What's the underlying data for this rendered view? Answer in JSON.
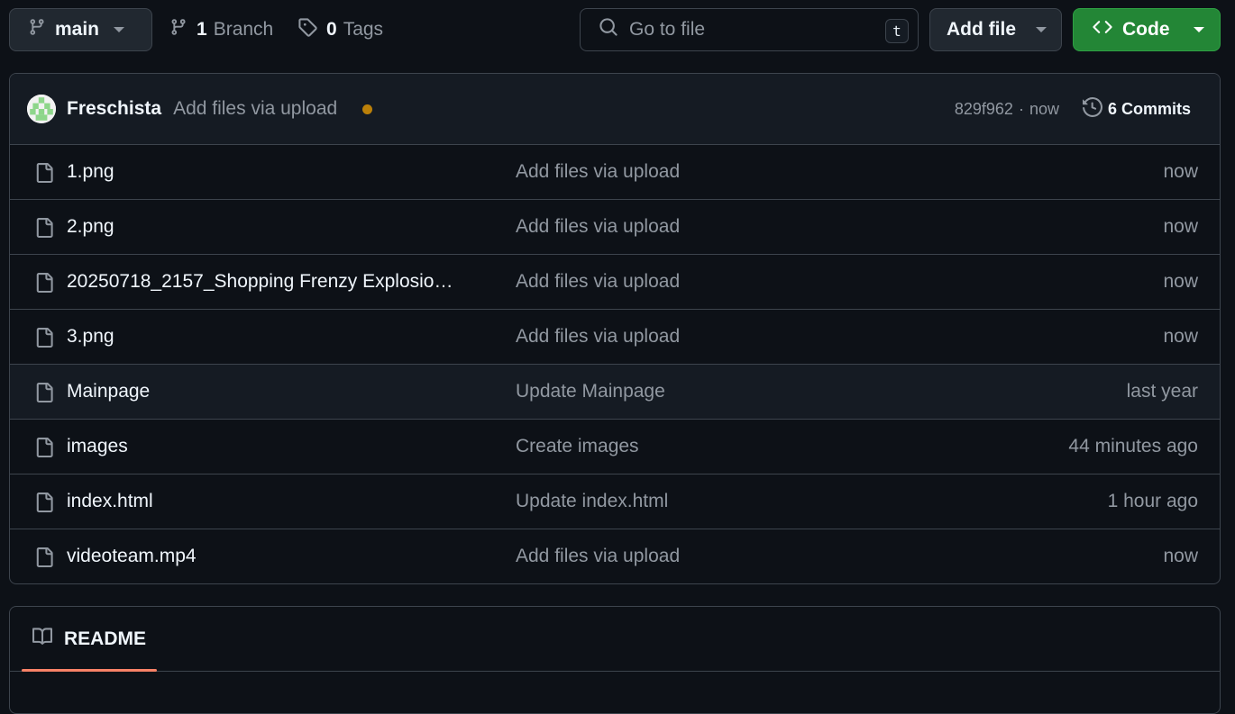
{
  "toolbar": {
    "branch": "main",
    "branches_count": "1",
    "branches_label": "Branch",
    "tags_count": "0",
    "tags_label": "Tags",
    "search_placeholder": "Go to file",
    "search_shortcut": "t",
    "add_file_label": "Add file",
    "code_label": "Code"
  },
  "latest_commit": {
    "author": "Freschista",
    "message": "Add files via upload",
    "hash": "829f962",
    "separator": "·",
    "time": "now",
    "commits_label": "6 Commits"
  },
  "files": [
    {
      "name": "1.png",
      "commit": "Add files via upload",
      "time": "now"
    },
    {
      "name": "2.png",
      "commit": "Add files via upload",
      "time": "now"
    },
    {
      "name": "20250718_2157_Shopping Frenzy Explosio…",
      "commit": "Add files via upload",
      "time": "now"
    },
    {
      "name": "3.png",
      "commit": "Add files via upload",
      "time": "now"
    },
    {
      "name": "Mainpage",
      "commit": "Update Mainpage",
      "time": "last year"
    },
    {
      "name": "images",
      "commit": "Create images",
      "time": "44 minutes ago"
    },
    {
      "name": "index.html",
      "commit": "Update index.html",
      "time": "1 hour ago"
    },
    {
      "name": "videoteam.mp4",
      "commit": "Add files via upload",
      "time": "now"
    }
  ],
  "readme": {
    "tab_label": "README"
  },
  "colors": {
    "background": "#0d1117",
    "border": "#3d444d",
    "code_button": "#238636",
    "status_dot": "#bb8009",
    "readme_accent": "#f78166"
  }
}
